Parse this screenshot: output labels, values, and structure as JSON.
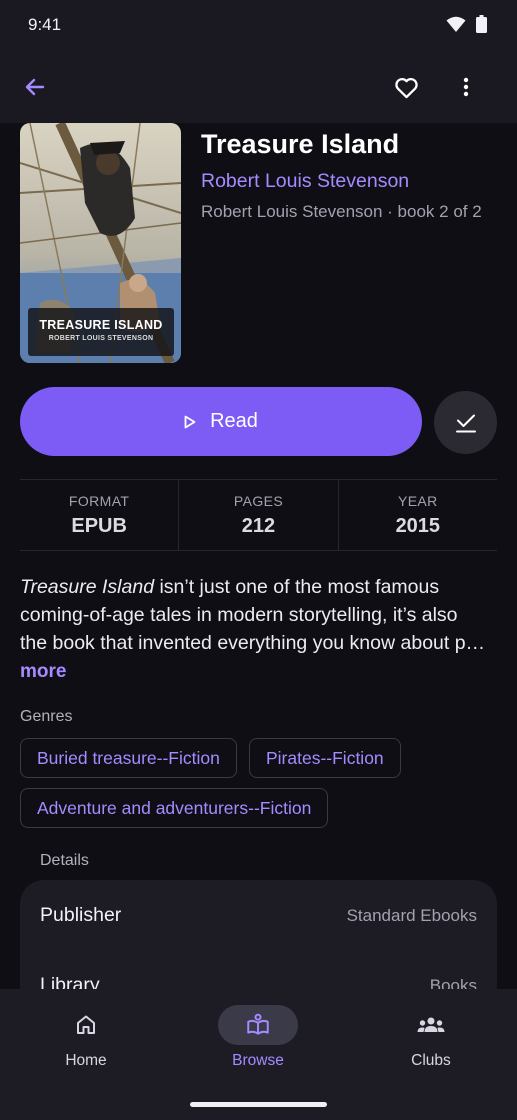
{
  "status_bar": {
    "time": "9:41"
  },
  "book": {
    "title": "Treasure Island",
    "author": "Robert Louis Stevenson",
    "series": "Robert Louis Stevenson · book 2 of 2",
    "cover": {
      "title": "TREASURE ISLAND",
      "author": "ROBERT LOUIS STEVENSON"
    }
  },
  "actions": {
    "read_label": "Read"
  },
  "stats": [
    {
      "label": "FORMAT",
      "value": "EPUB"
    },
    {
      "label": "PAGES",
      "value": "212"
    },
    {
      "label": "YEAR",
      "value": "2015"
    }
  ],
  "description": {
    "italic_title": "Treasure Island",
    "line1_rest": " isn’t just one of the most famous",
    "line2": "coming-of-age tales in modern storytelling, it’s also",
    "line3": "the book that invented everything you know about p…",
    "more_label": "more"
  },
  "genres": {
    "heading": "Genres",
    "items": [
      "Buried treasure--Fiction",
      "Pirates--Fiction",
      "Adventure and adventurers--Fiction"
    ]
  },
  "details": {
    "heading": "Details",
    "rows": [
      {
        "key": "Publisher",
        "value": "Standard Ebooks"
      },
      {
        "key": "Library",
        "value": "Books"
      }
    ]
  },
  "nav": {
    "items": [
      {
        "label": "Home",
        "icon": "home-icon",
        "active": false
      },
      {
        "label": "Browse",
        "icon": "book-open-icon",
        "active": true
      },
      {
        "label": "Clubs",
        "icon": "groups-icon",
        "active": false
      }
    ]
  },
  "colors": {
    "accent": "#7c5cf5",
    "accent_text": "#a58bff",
    "background": "#0f0e14",
    "surface": "#1a1922"
  }
}
